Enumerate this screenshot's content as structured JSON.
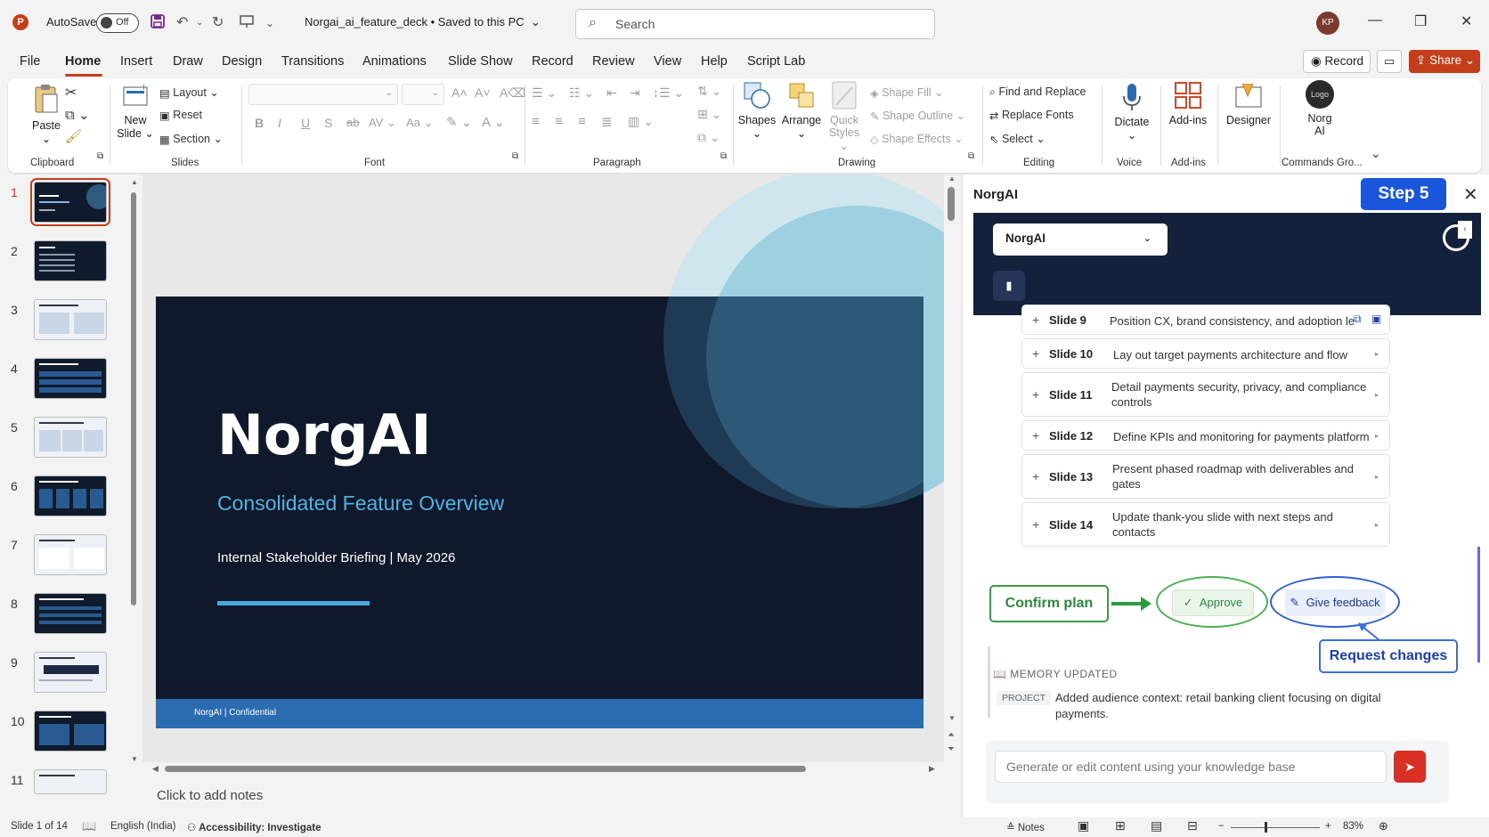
{
  "titlebar": {
    "app_logo": "P",
    "autosave_label": "AutoSave",
    "autosave_state": "Off",
    "doc_title": "Norgai_ai_feature_deck • Saved to this PC",
    "search_placeholder": "Search",
    "avatar_initials": "KP",
    "icons": [
      "save-icon",
      "undo-icon",
      "redo-icon",
      "present-icon",
      "customize-icon"
    ]
  },
  "menu": {
    "tabs": [
      "File",
      "Home",
      "Insert",
      "Draw",
      "Design",
      "Transitions",
      "Animations",
      "Slide Show",
      "Record",
      "Review",
      "View",
      "Help",
      "Script Lab"
    ],
    "active_tab": "Home",
    "record_label": "Record",
    "share_label": "Share"
  },
  "ribbon": {
    "clipboard": {
      "paste": "Paste",
      "group": "Clipboard"
    },
    "slides": {
      "new_slide_1": "New",
      "new_slide_2": "Slide",
      "layout": "Layout",
      "reset": "Reset",
      "section": "Section",
      "group": "Slides"
    },
    "font": {
      "group": "Font",
      "bold": "B",
      "italic": "I",
      "underline": "U",
      "strike": "S",
      "spacing": "AV",
      "case": "Aa"
    },
    "paragraph": {
      "group": "Paragraph"
    },
    "drawing": {
      "shapes": "Shapes",
      "arrange": "Arrange",
      "quick_styles_1": "Quick",
      "quick_styles_2": "Styles",
      "shape_fill": "Shape Fill",
      "shape_outline": "Shape Outline",
      "shape_effects": "Shape Effects",
      "group": "Drawing"
    },
    "editing": {
      "find_replace": "Find and Replace",
      "replace_fonts": "Replace Fonts",
      "select": "Select",
      "group": "Editing"
    },
    "voice": {
      "dictate": "Dictate",
      "group": "Voice"
    },
    "addins": {
      "addins": "Add-ins",
      "group": "Add-ins"
    },
    "designer": {
      "label": "Designer"
    },
    "commands": {
      "logo_text": "Logo",
      "norg_1": "Norg",
      "norg_2": "AI",
      "group": "Commands Gro..."
    }
  },
  "thumbnails": {
    "numbers": [
      "1",
      "2",
      "3",
      "4",
      "5",
      "6",
      "7",
      "8",
      "9",
      "10",
      "11"
    ],
    "selected": 1
  },
  "slide": {
    "title": "NorgAI",
    "subtitle": "Consolidated Feature Overview",
    "briefing": "Internal Stakeholder Briefing  |  May 2026",
    "footer": "NorgAI  |  Confidential"
  },
  "notes_placeholder": "Click to add notes",
  "panel": {
    "title": "NorgAI",
    "step_badge": "Step 5",
    "dropdown_value": "NorgAI",
    "slides": [
      {
        "num": "Slide 9",
        "desc": "Position CX, brand consistency, and adoption lev"
      },
      {
        "num": "Slide 10",
        "desc": "Lay out target payments architecture and flow"
      },
      {
        "num": "Slide 11",
        "desc": "Detail payments security, privacy, and compliance controls"
      },
      {
        "num": "Slide 12",
        "desc": "Define KPIs and monitoring for payments platform"
      },
      {
        "num": "Slide 13",
        "desc": "Present phased roadmap with deliverables and gates"
      },
      {
        "num": "Slide 14",
        "desc": "Update thank-you slide with next steps and contacts"
      }
    ],
    "confirm_plan": "Confirm plan",
    "approve": "Approve",
    "give_feedback": "Give feedback",
    "request_changes": "Request changes",
    "memory_title": "MEMORY UPDATED",
    "memory_tag": "PROJECT",
    "memory_text": "Added audience context: retail banking client focusing on digital payments.",
    "chat_placeholder": "Generate or edit content using your knowledge base"
  },
  "status": {
    "slide_of": "Slide 1 of 14",
    "language": "English (India)",
    "accessibility": "Accessibility: Investigate",
    "notes": "Notes",
    "zoom": "83%"
  },
  "colors": {
    "accent": "#c43e1c",
    "slide_bg": "#10192b",
    "subtitle": "#4fb3e3",
    "step_badge": "#1a56db",
    "approve_green": "#2b8a3e",
    "feedback_blue": "#1d3a8a"
  }
}
